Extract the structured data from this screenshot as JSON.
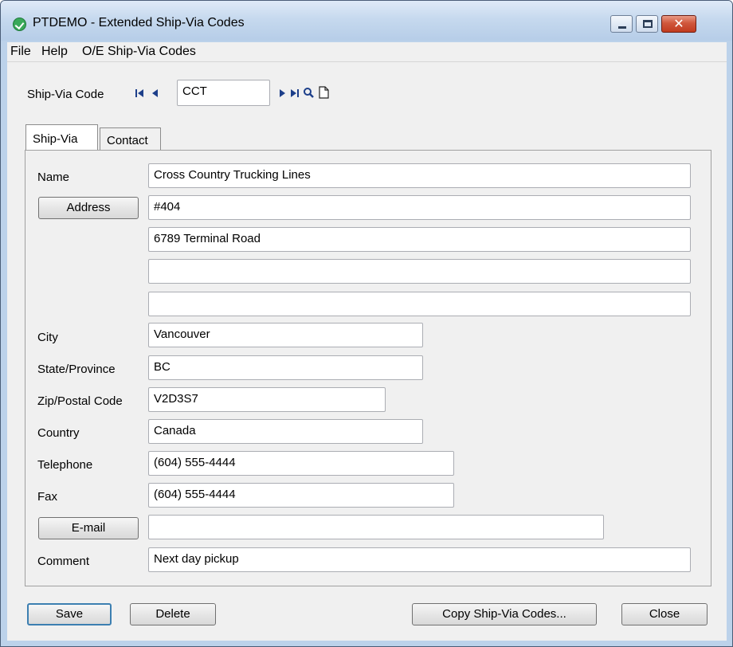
{
  "window": {
    "title": "PTDEMO - Extended Ship-Via Codes"
  },
  "menu": [
    {
      "label": "File"
    },
    {
      "label": "Help"
    },
    {
      "label": "O/E Ship-Via Codes"
    }
  ],
  "header": {
    "ship_via_label": "Ship-Via Code",
    "ship_via_code": "CCT"
  },
  "tabs": [
    {
      "label": "Ship-Via",
      "active": true
    },
    {
      "label": "Contact",
      "active": false
    }
  ],
  "form": {
    "name_label": "Name",
    "name": "Cross Country Trucking Lines",
    "address_button": "Address",
    "address_lines": [
      "#404",
      "6789 Terminal Road",
      "",
      ""
    ],
    "city_label": "City",
    "city": "Vancouver",
    "state_label": "State/Province",
    "state": "BC",
    "zip_label": "Zip/Postal Code",
    "zip": "V2D3S7",
    "country_label": "Country",
    "country": "Canada",
    "telephone_label": "Telephone",
    "telephone": "(604) 555-4444",
    "fax_label": "Fax",
    "fax": "(604) 555-4444",
    "email_button": "E-mail",
    "email": "",
    "comment_label": "Comment",
    "comment": "Next day pickup"
  },
  "buttons": {
    "save": "Save",
    "delete": "Delete",
    "copy": "Copy Ship-Via Codes...",
    "close": "Close"
  },
  "icons": [
    "first-icon",
    "previous-icon",
    "next-icon",
    "last-icon",
    "finder-icon",
    "new-icon",
    "minimize-icon",
    "maximize-icon",
    "close-icon"
  ]
}
